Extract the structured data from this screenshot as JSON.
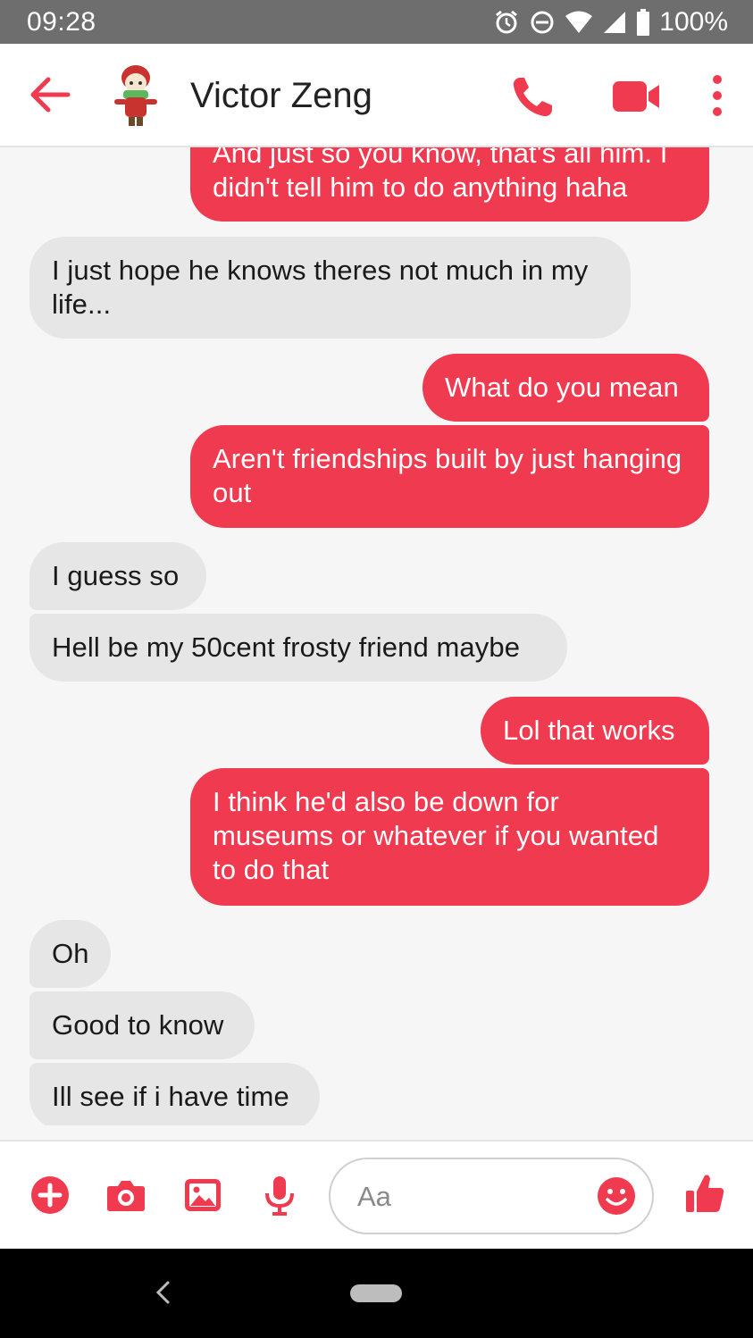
{
  "status_bar": {
    "time": "09:28",
    "battery": "100%",
    "icons": [
      "alarm-icon",
      "do-not-disturb-icon",
      "wifi-icon",
      "signal-icon",
      "battery-icon"
    ]
  },
  "header": {
    "contact_name": "Victor Zeng",
    "icons": [
      "back-arrow-icon",
      "avatar",
      "phone-icon",
      "video-icon",
      "more-vert-icon"
    ]
  },
  "colors": {
    "accent": "#f03a4f",
    "incoming_bubble": "#e6e6e6",
    "background": "#f6f6f6"
  },
  "messages": [
    {
      "direction": "out",
      "text": "And just so you know, that's all him. I didn't tell him to do anything haha"
    },
    {
      "direction": "in",
      "text": "I just hope he knows theres not much in my life..."
    },
    {
      "direction": "out",
      "text": "What do you mean"
    },
    {
      "direction": "out",
      "text": "Aren't friendships built by just hanging out"
    },
    {
      "direction": "in",
      "text": "I guess so"
    },
    {
      "direction": "in",
      "text": "Hell be my 50cent frosty friend maybe"
    },
    {
      "direction": "out",
      "text": "Lol that works"
    },
    {
      "direction": "out",
      "text": "I think he'd also be down for museums or whatever if you wanted to do that"
    },
    {
      "direction": "in",
      "text": "Oh"
    },
    {
      "direction": "in",
      "text": "Good to know"
    },
    {
      "direction": "in",
      "text": "Ill see if i have time"
    }
  ],
  "composer": {
    "placeholder": "Aa",
    "icons": [
      "add-icon",
      "camera-icon",
      "gallery-icon",
      "microphone-icon",
      "emoji-icon",
      "thumbs-up-icon"
    ]
  },
  "nav_bar": {
    "icons": [
      "nav-back-icon",
      "home-pill"
    ]
  }
}
